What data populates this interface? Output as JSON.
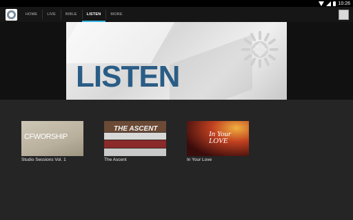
{
  "status_bar": {
    "time": "10:26"
  },
  "nav": {
    "tabs": [
      {
        "label": "HOME",
        "active": false
      },
      {
        "label": "LIVE",
        "active": false
      },
      {
        "label": "BIBLE",
        "active": false
      },
      {
        "label": "LISTEN",
        "active": true
      },
      {
        "label": "MORE",
        "active": false
      }
    ],
    "accent_color": "#33b5e5"
  },
  "hero": {
    "title": "LISTEN",
    "title_color": "#2a5d86"
  },
  "albums": [
    {
      "title": "Studio Sessions Vol. 1",
      "cover_text": "CFWORSHIP"
    },
    {
      "title": "The Ascent",
      "cover_text": "THE ASCENT"
    },
    {
      "title": "In Your Love",
      "cover_text": "In Your LOVE"
    }
  ]
}
